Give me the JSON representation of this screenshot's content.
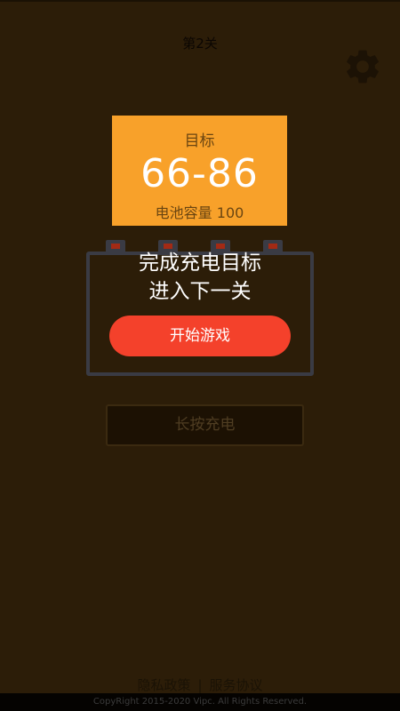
{
  "header": {
    "level_title": "第2关",
    "settings_icon": "gear-icon"
  },
  "target": {
    "label": "目标",
    "range": "66-86",
    "capacity": "电池容量 100"
  },
  "overlay": {
    "line1": "完成充电目标",
    "line2": "进入下一关",
    "start_label": "开始游戏"
  },
  "charge_button": {
    "label": "长按充电"
  },
  "footer": {
    "privacy": "隐私政策",
    "separator": "|",
    "service": "服务协议",
    "copyright": "CopyRight 2015-2020 Vipc. All Rights Reserved."
  },
  "colors": {
    "background": "#2c1d08",
    "target_card": "#f8a12a",
    "start_button": "#f4412b",
    "battery_outline": "#3a3b44"
  }
}
